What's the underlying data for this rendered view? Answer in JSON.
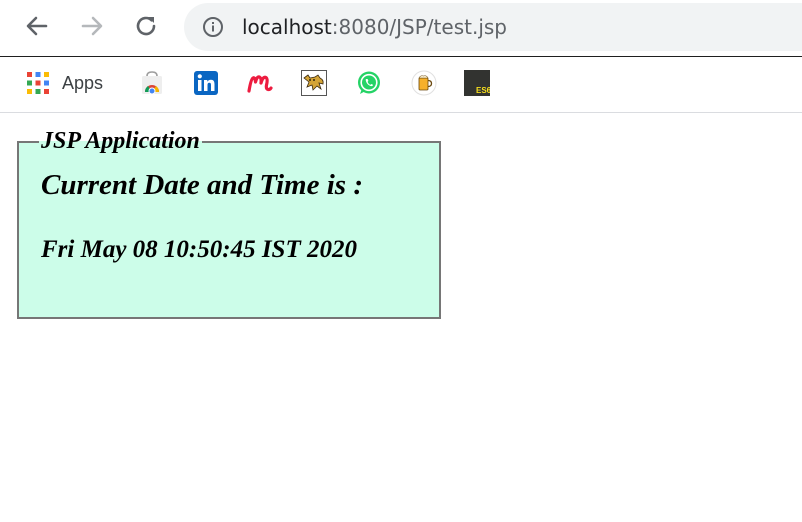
{
  "browser": {
    "url_host": "localhost",
    "url_path": ":8080/JSP/test.jsp"
  },
  "bookmarks": {
    "apps_label": "Apps",
    "es6_label": "ES6",
    "items": [
      {
        "icon": "chrome-web-store-icon"
      },
      {
        "icon": "linkedin-icon"
      },
      {
        "icon": "meetup-icon"
      },
      {
        "icon": "tomcat-icon"
      },
      {
        "icon": "whatsapp-icon"
      },
      {
        "icon": "beer-mug-icon"
      },
      {
        "icon": "es6-icon"
      }
    ]
  },
  "page": {
    "legend": "JSP Application",
    "heading": "Current Date and Time is :",
    "datetime": "Fri May 08 10:50:45 IST 2020",
    "panel_color": "#ccfde9"
  }
}
